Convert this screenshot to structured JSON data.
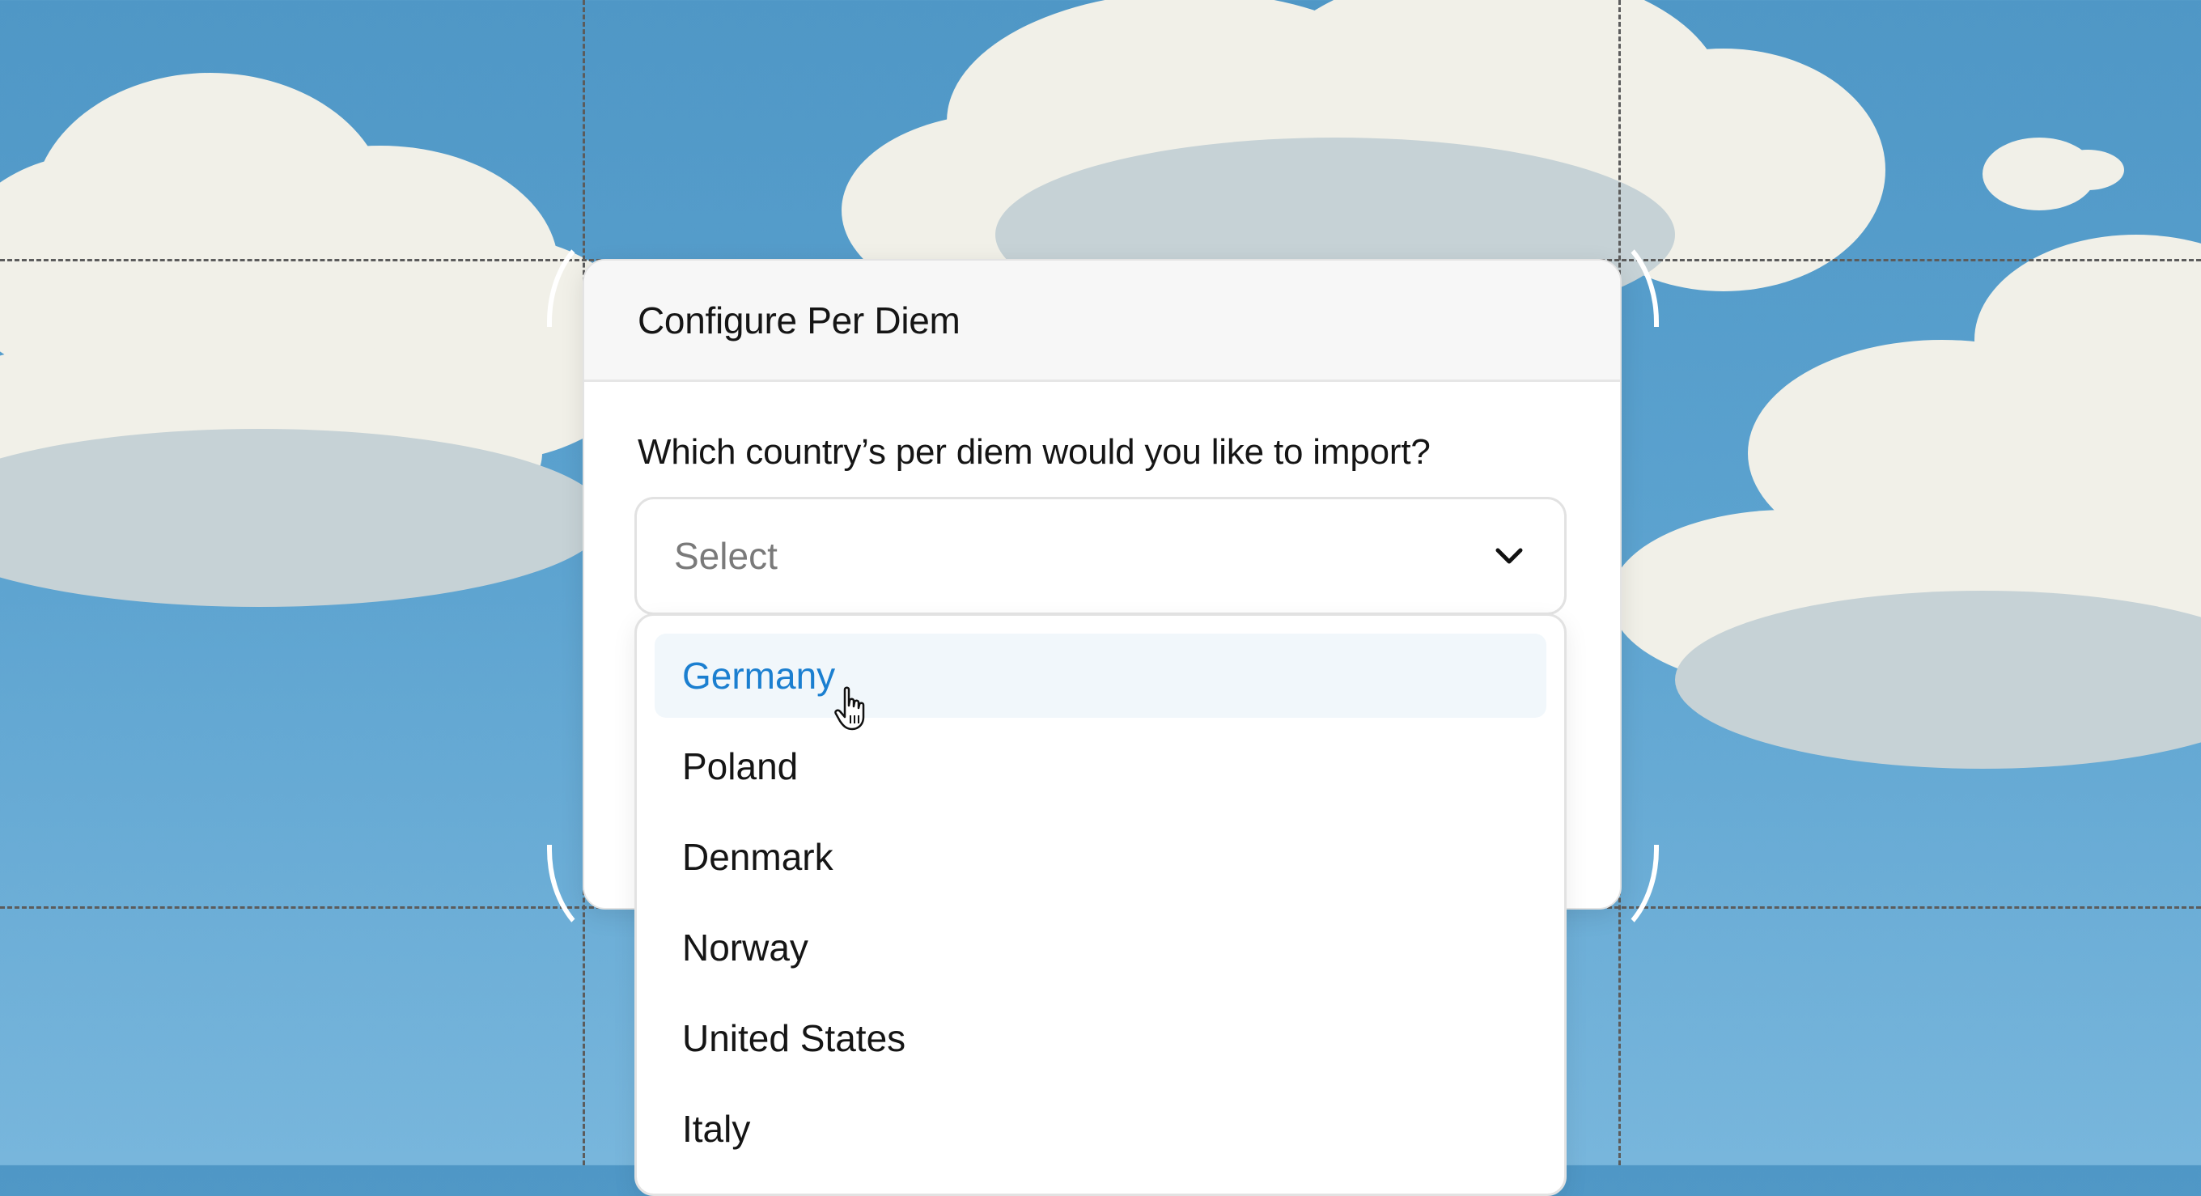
{
  "dialog": {
    "title": "Configure Per Diem",
    "question": "Which country’s per diem would you like to import?"
  },
  "select": {
    "placeholder": "Select",
    "icon": "chevron-down-icon"
  },
  "dropdown": {
    "options": [
      {
        "label": "Germany",
        "hovered": true
      },
      {
        "label": "Poland"
      },
      {
        "label": "Denmark"
      },
      {
        "label": "Norway"
      },
      {
        "label": "United States"
      },
      {
        "label": "Italy"
      }
    ]
  },
  "colors": {
    "sky": "#5ba2cf",
    "accent": "#1b7fd0",
    "hover_background": "#f1f7fb"
  }
}
